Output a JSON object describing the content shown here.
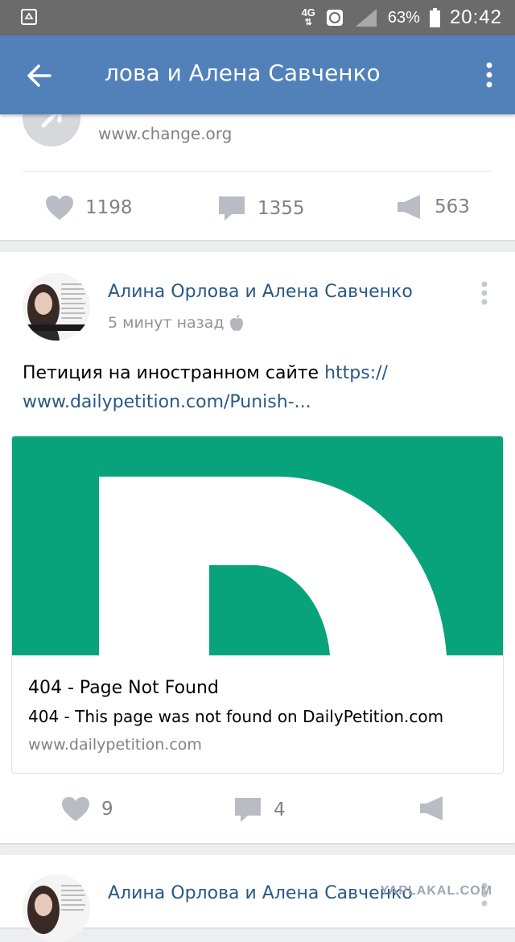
{
  "status_bar": {
    "network": "4G",
    "battery": "63%",
    "time": "20:42"
  },
  "app_bar": {
    "title": "лова и Алена Савченко"
  },
  "card1": {
    "link_url": "www.change.org",
    "likes": "1198",
    "comments": "1355",
    "shares": "563"
  },
  "post": {
    "author": "Алина Орлова и Алена Савченко",
    "time": "5 минут назад",
    "text": "Петиция на иностранном сайте ",
    "link_part1": "https://",
    "link_part2": "www.dailypetition.com/Punish-...",
    "attachment": {
      "title": "404 - Page Not Found",
      "description": "404 - This page was not found on DailyPetition.com",
      "url": "www.dailypetition.com",
      "image_color": "#08a37a"
    },
    "likes": "9",
    "comments": "4"
  },
  "next_post": {
    "author": "Алина Орлова и Алена Савченко"
  },
  "watermark": "YAPLAKAL.COM",
  "colors": {
    "header": "#5181b8",
    "link": "#2a5885",
    "muted": "#828282"
  }
}
